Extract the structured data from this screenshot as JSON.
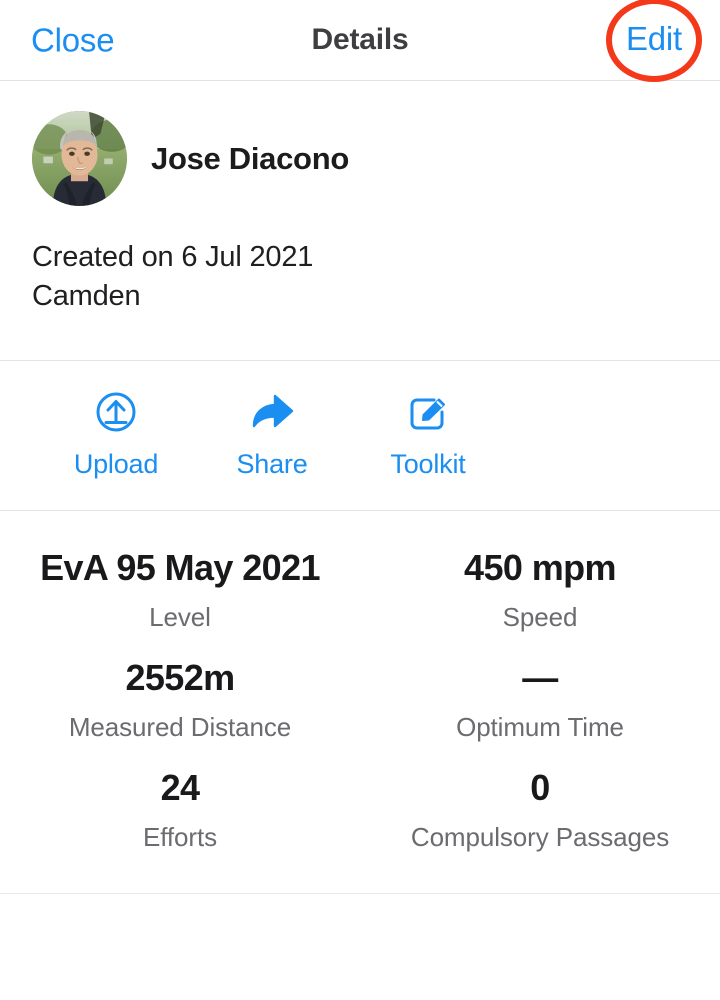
{
  "theme": {
    "accent_blue": "#1b8ef2",
    "annotation_red": "#f4391a",
    "text_primary": "#1c1c1e",
    "text_secondary": "#6b6b70",
    "divider": "#e4e4e6",
    "background": "#ffffff"
  },
  "header": {
    "close_label": "Close",
    "title": "Details",
    "edit_label": "Edit",
    "edit_annotation": "red-ellipse-highlight"
  },
  "profile": {
    "avatar_icon": "user-photo-avatar",
    "avatar_alt": "Portrait photo of a person with short grey hair wearing a dark jacket outdoors",
    "name": "Jose Diacono",
    "created_line": "Created on 6 Jul 2021",
    "location_line": "Camden"
  },
  "actions": [
    {
      "label": "Upload",
      "icon": "upload-circle-icon"
    },
    {
      "label": "Share",
      "icon": "share-arrow-icon"
    },
    {
      "label": "Toolkit",
      "icon": "pencil-square-icon"
    }
  ],
  "stats": [
    [
      {
        "value": "EvA 95 May 2021",
        "label": "Level"
      },
      {
        "value": "450 mpm",
        "label": "Speed"
      }
    ],
    [
      {
        "value": "2552m",
        "label": "Measured Distance"
      },
      {
        "value": "—",
        "label": "Optimum Time"
      }
    ],
    [
      {
        "value": "24",
        "label": "Efforts"
      },
      {
        "value": "0",
        "label": "Compulsory Passages"
      }
    ]
  ]
}
